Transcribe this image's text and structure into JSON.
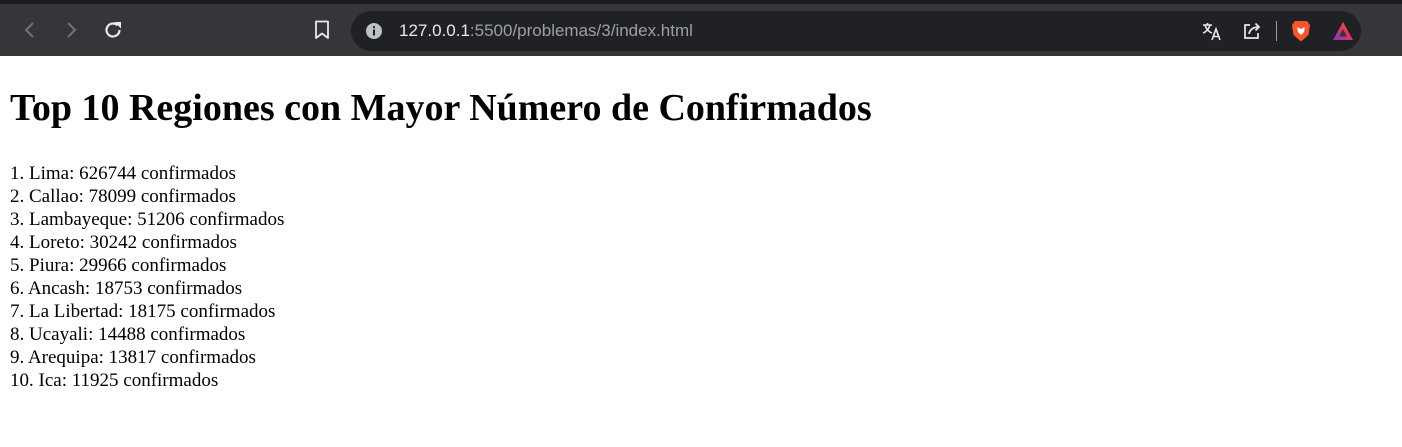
{
  "browser": {
    "url_host": "127.0.0.1",
    "url_rest": ":5500/problemas/3/index.html",
    "icons": [
      "back-icon",
      "forward-icon",
      "reload-icon",
      "bookmark-icon",
      "site-info-icon",
      "translate-icon",
      "share-icon",
      "brave-shields-icon",
      "brave-rewards-icon"
    ],
    "colors": {
      "toolbar": "#35363a",
      "omnibox": "#202124",
      "brave_orange": "#fb542b"
    }
  },
  "page": {
    "title": "Top 10 Regiones con Mayor Número de Confirmados",
    "items": [
      "1. Lima: 626744 confirmados",
      "2. Callao: 78099 confirmados",
      "3. Lambayeque: 51206 confirmados",
      "4. Loreto: 30242 confirmados",
      "5. Piura: 29966 confirmados",
      "6. Ancash: 18753 confirmados",
      "7. La Libertad: 18175 confirmados",
      "8. Ucayali: 14488 confirmados",
      "9. Arequipa: 13817 confirmados",
      "10. Ica: 11925 confirmados"
    ]
  }
}
